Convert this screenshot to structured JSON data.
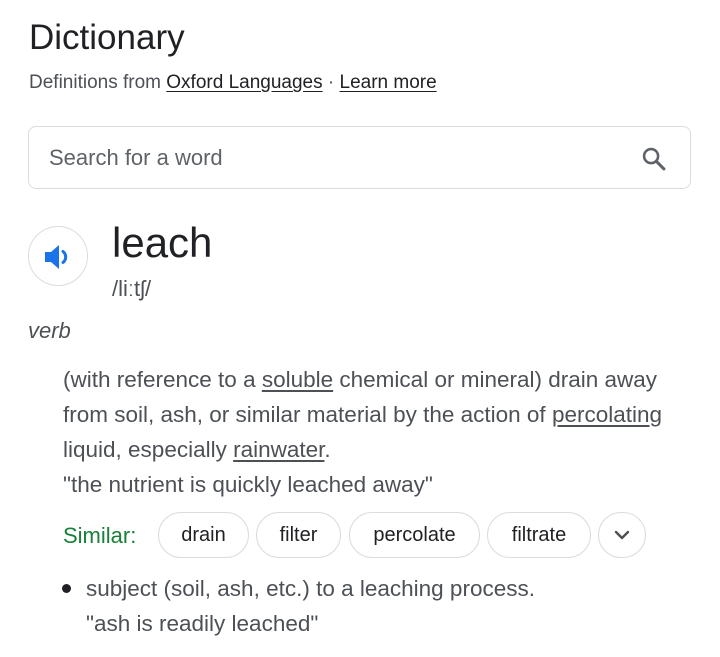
{
  "header": {
    "title": "Dictionary",
    "source_prefix": "Definitions from",
    "source_link": "Oxford Languages",
    "separator": "·",
    "learn_more": "Learn more"
  },
  "search": {
    "placeholder": "Search for a word",
    "icon": "search-icon"
  },
  "entry": {
    "audio_icon": "speaker-icon",
    "word": "leach",
    "phonetic": "/liːtʃ/",
    "part_of_speech": "verb",
    "senses": [
      {
        "definition_parts": [
          "(with reference to a ",
          "soluble",
          " chemical or mineral) drain away from soil, ash, or similar material by the action of ",
          "percolating",
          " liquid, especially ",
          "rainwater",
          "."
        ],
        "example": "\"the nutrient is quickly leached away\"",
        "similar_label": "Similar:",
        "similar": [
          "drain",
          "filter",
          "percolate",
          "filtrate"
        ],
        "expand_icon": "chevron-down-icon"
      },
      {
        "definition": "subject (soil, ash, etc.) to a leaching process.",
        "example": "\"ash is readily leached\""
      }
    ]
  },
  "colors": {
    "text_primary": "#202124",
    "text_secondary": "#4d5156",
    "similar_label": "#188038",
    "accent_blue": "#1a73e8",
    "border": "#dadce0"
  }
}
